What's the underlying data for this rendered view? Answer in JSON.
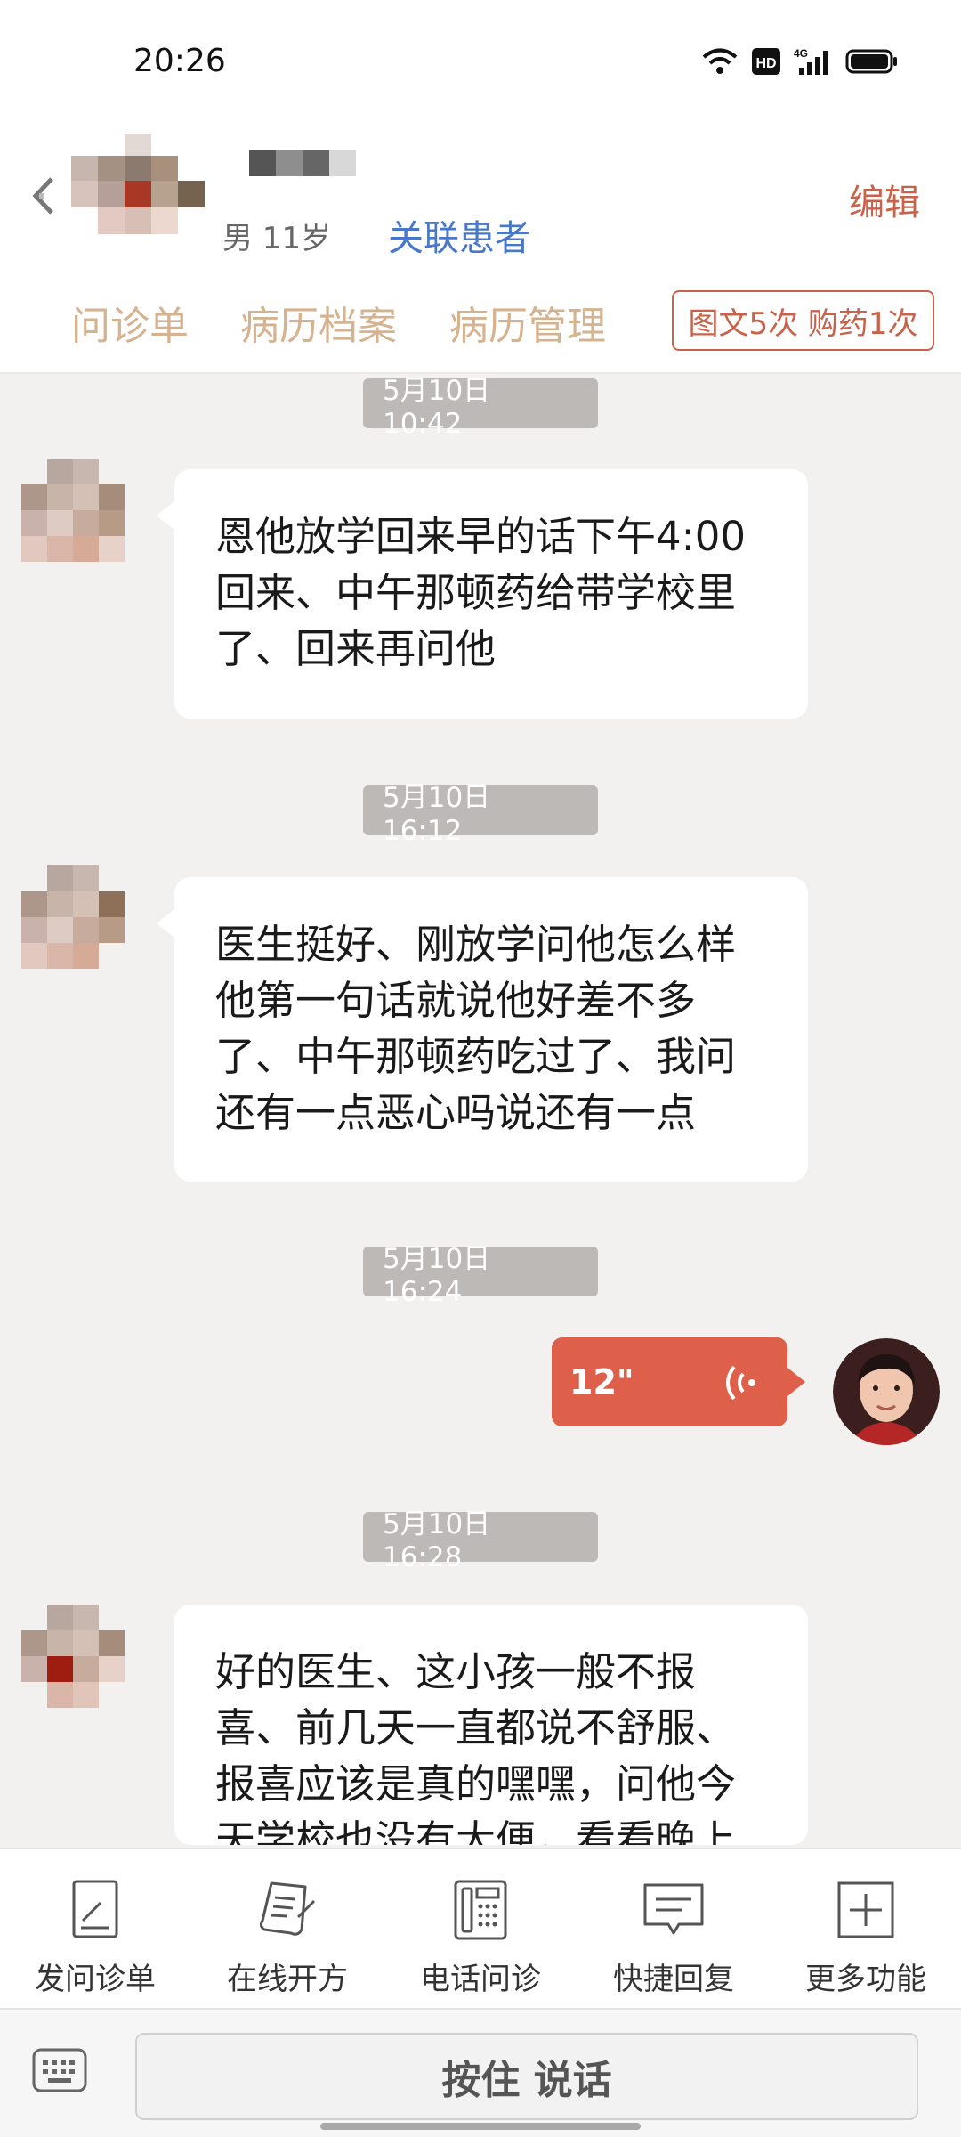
{
  "status_bar": {
    "time": "20:26",
    "network": "4G",
    "hd_label": "HD"
  },
  "header": {
    "patient_info": "男 11岁",
    "link_patient": "关联患者",
    "edit": "编辑"
  },
  "tabs": [
    {
      "label": "问诊单"
    },
    {
      "label": "病历档案"
    },
    {
      "label": "病历管理"
    }
  ],
  "quota_badge": "图文5次 购药1次",
  "messages": [
    {
      "time": "5月10日 10:42",
      "text": "恩他放学回来早的话下午4:00回来、中午那顿药给带学校里了、回来再问他"
    },
    {
      "time": "5月10日 16:12",
      "text": "医生挺好、刚放学问他怎么样他第一句话就说他好差不多了、中午那顿药吃过了、我问还有一点恶心吗说还有一点"
    },
    {
      "time": "5月10日 16:24",
      "voice_duration": "12\""
    },
    {
      "time": "5月10日 16:28",
      "text": "好的医生、这小孩一般不报喜、前几天一直都说不舒服、报喜应该是真的嘿嘿，问他今天学校也没有大便，看看晚上"
    }
  ],
  "toolbar": [
    {
      "label": "发问诊单",
      "icon": "form-icon"
    },
    {
      "label": "在线开方",
      "icon": "prescription-icon"
    },
    {
      "label": "电话问诊",
      "icon": "phone-icon"
    },
    {
      "label": "快捷回复",
      "icon": "quick-reply-icon"
    },
    {
      "label": "更多功能",
      "icon": "plus-icon"
    }
  ],
  "input": {
    "talk_button": "按住 说话"
  },
  "colors": {
    "accent": "#c9624a",
    "link": "#4a78c9",
    "tab_text": "#d6b38f",
    "voice_bubble": "#de5f4a",
    "time_pill": "#bcb9b6"
  }
}
